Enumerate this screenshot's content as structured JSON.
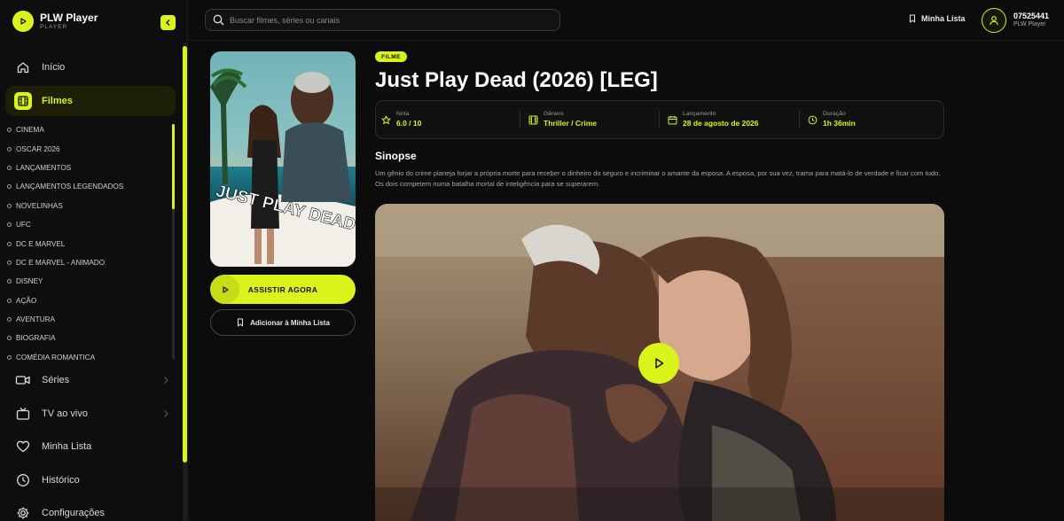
{
  "brand": {
    "name": "PLW Player",
    "sub": "PLAYER"
  },
  "colors": {
    "accent": "#d9f31b",
    "background": "#0c0c0c"
  },
  "search": {
    "placeholder": "Buscar filmes, séries ou canais"
  },
  "header": {
    "my_list": "Minha Lista"
  },
  "user": {
    "id": "07525441",
    "sub": "PLW Player"
  },
  "nav": {
    "home": "Início",
    "movies": "Filmes",
    "series": "Séries",
    "live_tv": "TV ao vivo",
    "my_list": "Minha Lista",
    "history": "Histórico",
    "settings": "Configurações"
  },
  "categories": [
    "CINEMA",
    "OSCAR 2026",
    "LANÇAMENTOS",
    "LANÇAMENTOS LEGENDADOS",
    "NOVELINHAS",
    "UFC",
    "DC E MARVEL",
    "DC E MARVEL - ANIMADO",
    "DISNEY",
    "AÇÃO",
    "AVENTURA",
    "BIOGRAFIA",
    "COMÉDIA ROMANTICA"
  ],
  "movie": {
    "type": "FILME",
    "title": "Just Play Dead (2026) [LEG]",
    "poster_text": "JUST PLAY DEAD",
    "info": {
      "rating_label": "Nota",
      "rating": "6.0 / 10",
      "genre_label": "Gênero",
      "genre": "Thriller / Crime",
      "release_label": "Lançamento",
      "release": "28 de agosto de 2026",
      "duration_label": "Duração",
      "duration": "1h 36min"
    },
    "synopsis_title": "Sinopse",
    "synopsis": "Um gênio do crime planeja forjar a própria morte para receber o dinheiro do seguro e incriminar o amante da esposa. A esposa, por sua vez, trama para matá-lo de verdade e ficar com tudo. Os dois competem numa batalha mortal de inteligência para se superarem.",
    "watch_label": "ASSISTIR AGORA",
    "add_list_label": "Adicionar à Minha Lista"
  }
}
